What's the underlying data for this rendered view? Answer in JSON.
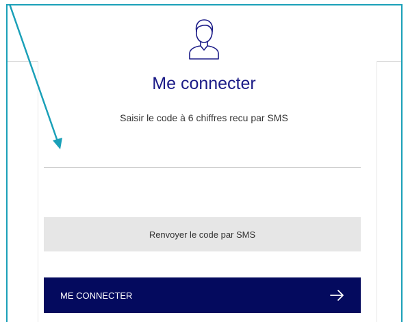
{
  "login": {
    "title": "Me connecter",
    "instruction": "Saisir le code à 6 chiffres recu par SMS",
    "code_field": {
      "value": "",
      "placeholder": ""
    },
    "resend_label": "Renvoyer le code par SMS",
    "connect_label": "ME CONNECTER",
    "icons": {
      "user": "user-icon",
      "arrow": "arrow-right-icon"
    }
  },
  "colors": {
    "title": "#1b1b87",
    "primary_button": "#040a5e",
    "secondary_button": "#e6e6e6",
    "annotation": "#1aa0b8"
  }
}
